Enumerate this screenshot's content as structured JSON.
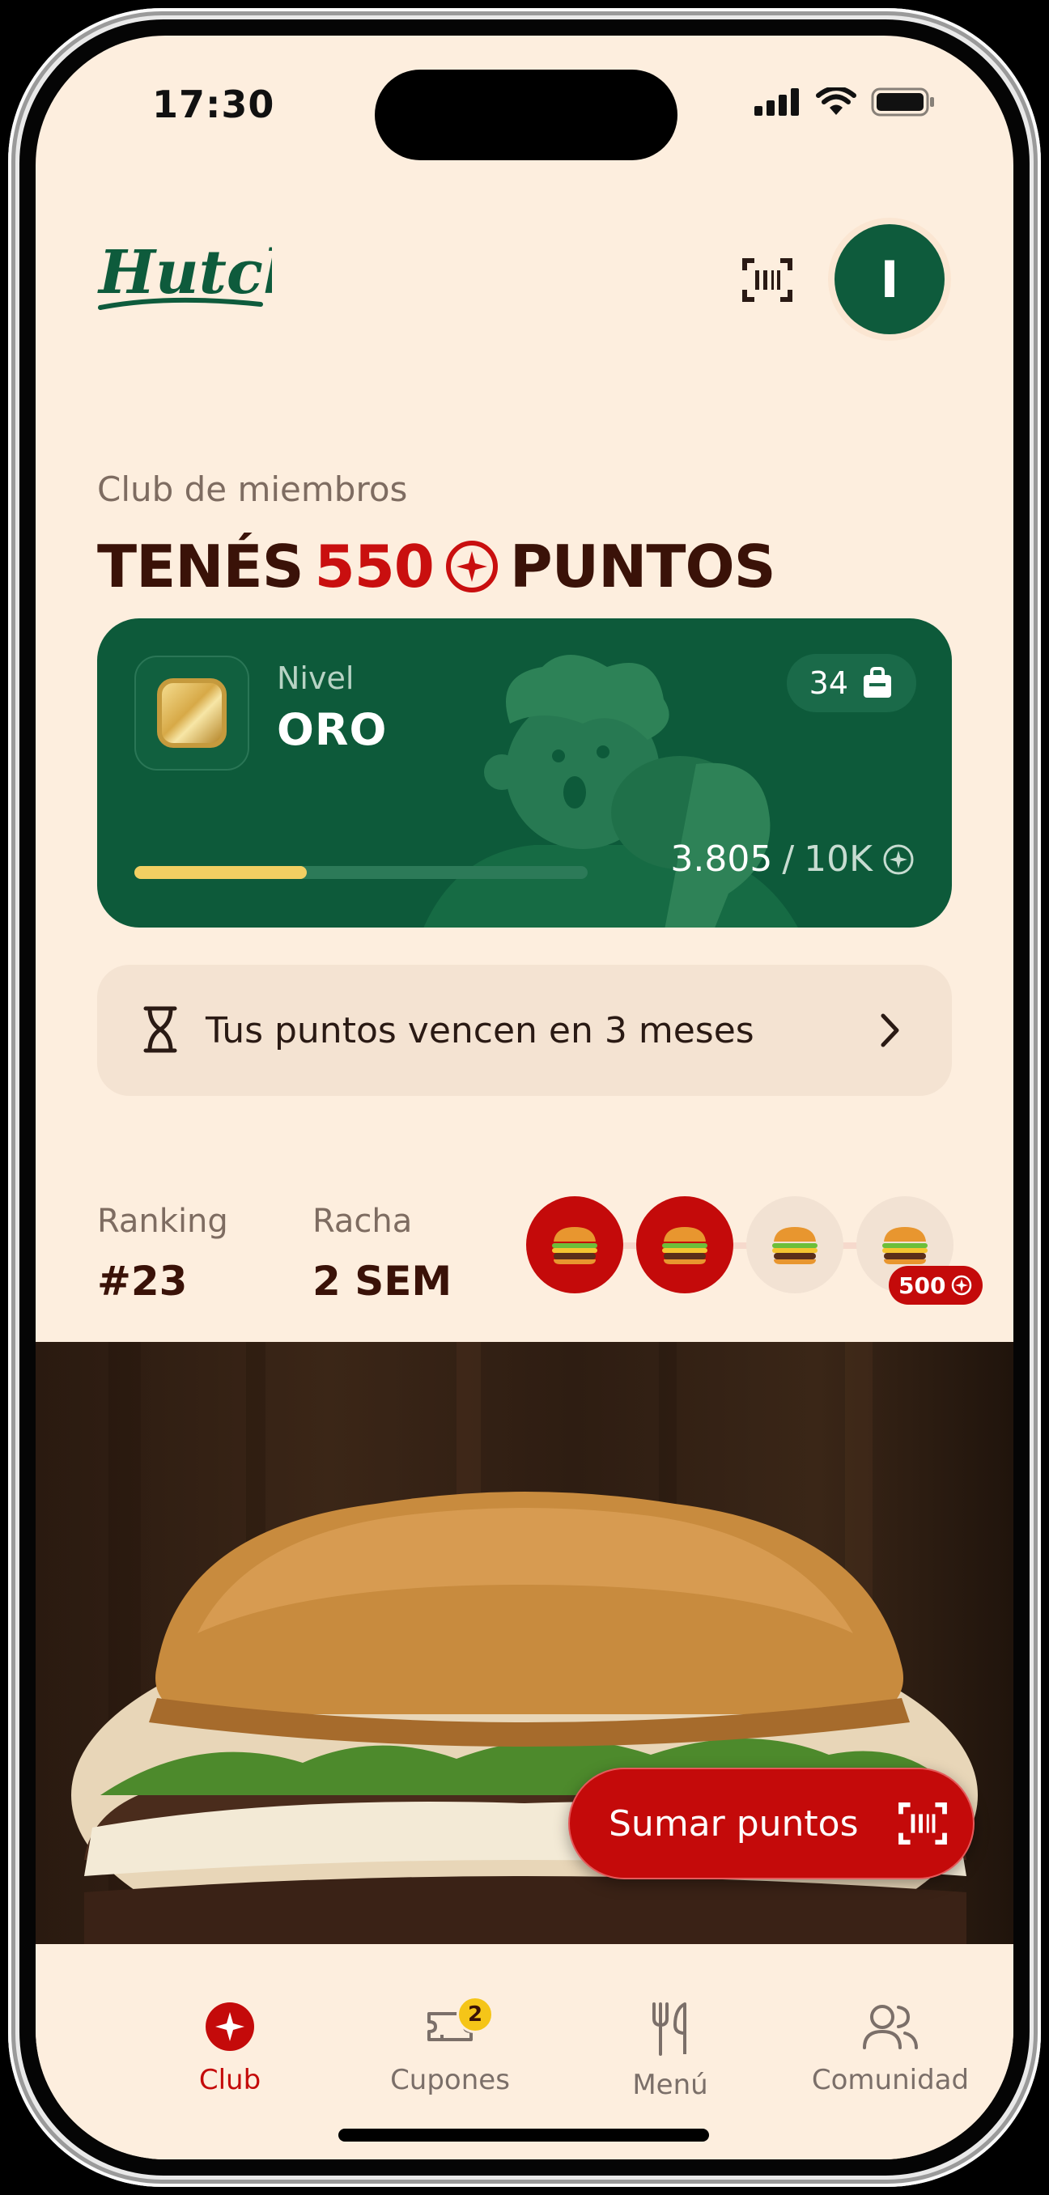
{
  "status_bar": {
    "time": "17:30"
  },
  "header": {
    "logo_text": "Hutch",
    "avatar_initial": "I"
  },
  "club": {
    "label": "Club de miembros",
    "title_prefix": "TENÉS",
    "points": "550",
    "title_suffix": "PUNTOS"
  },
  "level_card": {
    "level_label": "Nivel",
    "level_name": "ORO",
    "coupons_count": "34",
    "progress_current": "3.805",
    "progress_max": "10K",
    "progress_fraction": 0.3805
  },
  "expiry": {
    "text": "Tus puntos vencen en 3 meses"
  },
  "stats": {
    "ranking_label": "Ranking",
    "ranking_value": "#23",
    "streak_label": "Racha",
    "streak_value": "2 SEM",
    "streak_weeks_completed": 2,
    "streak_weeks_total": 4,
    "streak_bonus": "500"
  },
  "hero": {
    "cta_label": "Sumar puntos"
  },
  "tabbar": {
    "items": [
      {
        "label": "Club",
        "icon": "star-badge-icon",
        "active": true
      },
      {
        "label": "Cupones",
        "icon": "ticket-icon",
        "badge": "2"
      },
      {
        "label": "Menú",
        "icon": "fork-knife-icon"
      },
      {
        "label": "Comunidad",
        "icon": "users-icon"
      }
    ]
  },
  "colors": {
    "background": "#fdeede",
    "brand_green": "#0d5a3a",
    "brand_red": "#c40a0a",
    "text_dark": "#3a1208",
    "progress_gold": "#f2cf62",
    "badge_yellow": "#f5c518"
  }
}
